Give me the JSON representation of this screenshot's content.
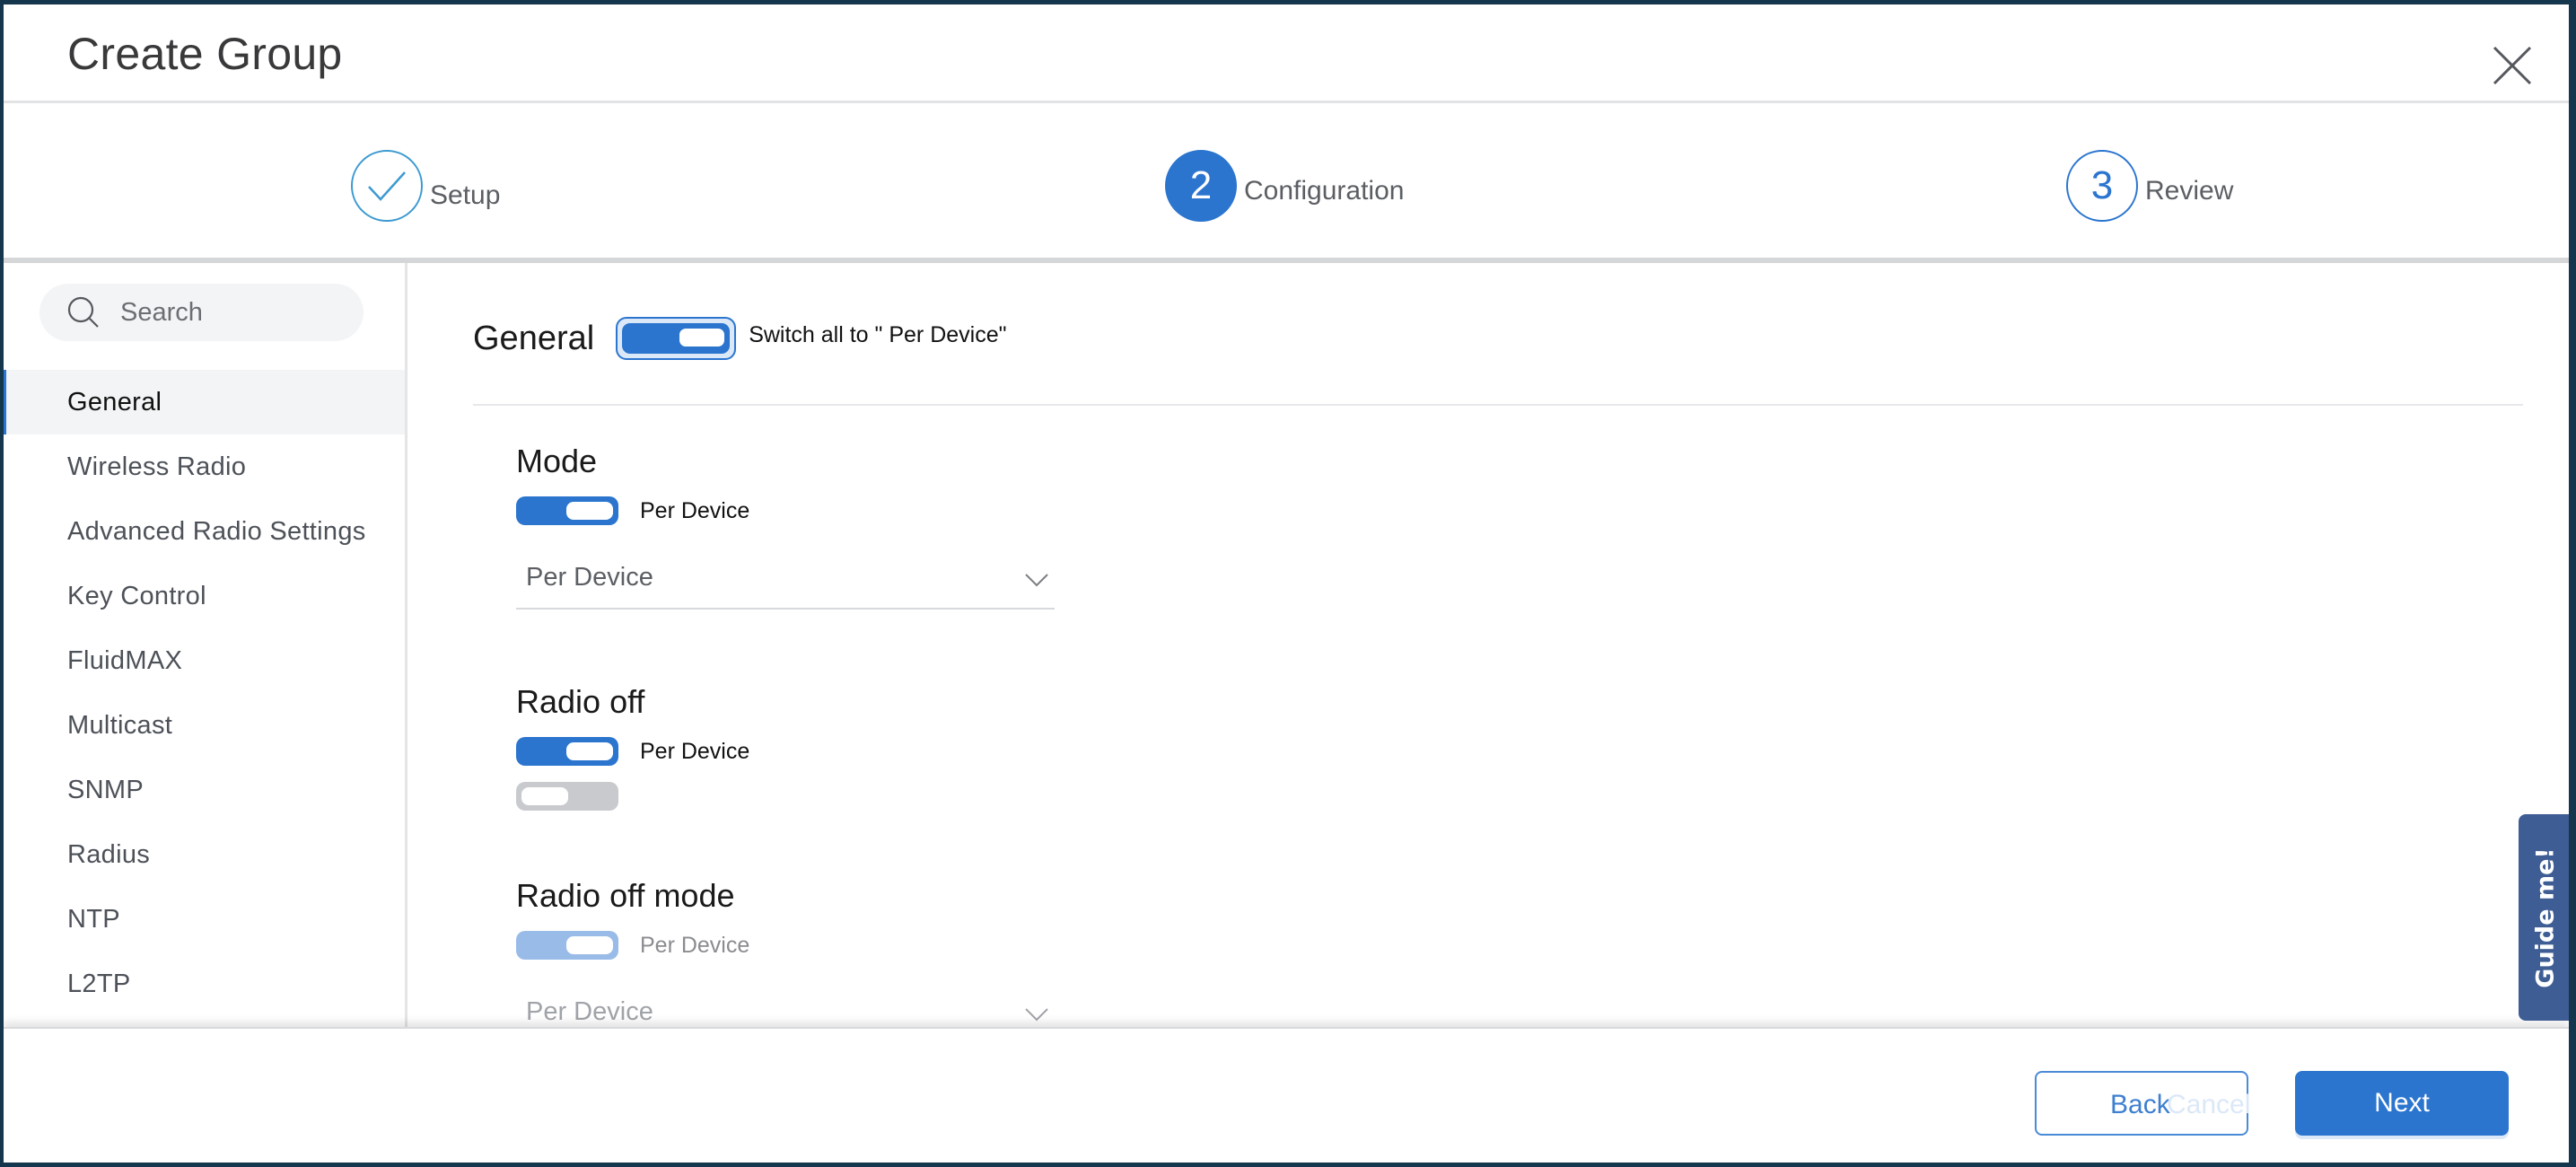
{
  "header": {
    "title": "Create Group",
    "close_icon": "close-icon"
  },
  "stepper": {
    "steps": [
      {
        "number": "1",
        "label": "Setup",
        "state": "completed",
        "icon": "check-icon"
      },
      {
        "number": "2",
        "label": "Configuration",
        "state": "active"
      },
      {
        "number": "3",
        "label": "Review",
        "state": "pending"
      }
    ]
  },
  "sidebar": {
    "search": {
      "placeholder": "Search",
      "value": "",
      "icon": "search-icon"
    },
    "items": [
      {
        "label": "General",
        "active": true
      },
      {
        "label": "Wireless Radio"
      },
      {
        "label": "Advanced Radio Settings"
      },
      {
        "label": "Key Control"
      },
      {
        "label": "FluidMAX"
      },
      {
        "label": "Multicast"
      },
      {
        "label": "SNMP"
      },
      {
        "label": "Radius"
      },
      {
        "label": "NTP"
      },
      {
        "label": "L2TP"
      }
    ]
  },
  "content": {
    "section_title": "General",
    "master_toggle": {
      "label": "Switch all to \" Per Device\"",
      "on": true
    },
    "fields": {
      "mode": {
        "title": "Mode",
        "toggle_label": "Per Device",
        "toggle_on": true,
        "select_value": "Per Device"
      },
      "radio_off": {
        "title": "Radio off",
        "toggle_label": "Per Device",
        "toggle_on": true,
        "value_toggle_on": false
      },
      "radio_off_mode": {
        "title": "Radio off mode",
        "toggle_label": "Per Device",
        "toggle_on": true,
        "disabled": true,
        "select_value": "Per Device"
      }
    }
  },
  "footer": {
    "back_label": "Back",
    "back_ghost_label": "Cancel",
    "next_label": "Next"
  },
  "guide": {
    "label": "Guide me!"
  },
  "colors": {
    "accent": "#2b75cf",
    "completed_step": "#3d9ad1",
    "frame": "#15374d",
    "guide_tab": "#3f5d95"
  }
}
